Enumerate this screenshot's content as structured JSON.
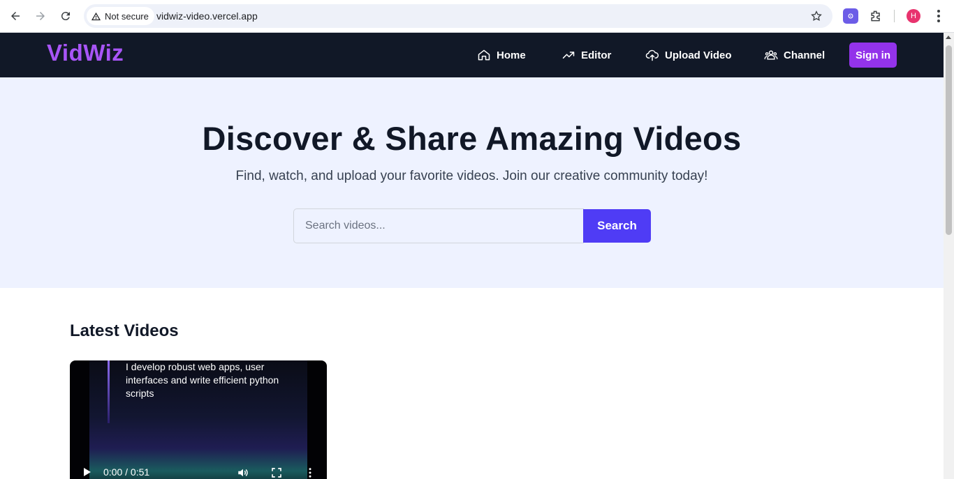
{
  "browser": {
    "security_label": "Not secure",
    "url": "vidwiz-video.vercel.app",
    "profile_initial": "H"
  },
  "header": {
    "logo": "VidWiz",
    "nav": [
      {
        "label": "Home",
        "icon": "home-icon"
      },
      {
        "label": "Editor",
        "icon": "trending-up-icon"
      },
      {
        "label": "Upload Video",
        "icon": "cloud-upload-icon"
      },
      {
        "label": "Channel",
        "icon": "users-icon"
      }
    ],
    "signin_label": "Sign in"
  },
  "hero": {
    "title": "Discover & Share Amazing Videos",
    "subtitle": "Find, watch, and upload your favorite videos. Join our creative community today!",
    "search_placeholder": "Search videos...",
    "search_button": "Search"
  },
  "latest": {
    "title": "Latest Videos",
    "videos": [
      {
        "caption": "I develop robust web apps, user interfaces and write efficient python scripts",
        "time": "0:00 / 0:51"
      }
    ]
  },
  "colors": {
    "header_bg": "#111827",
    "logo": "#a855f7",
    "signin_bg": "#9333ea",
    "hero_bg": "#eef2ff",
    "search_btn": "#4f3cf5"
  }
}
